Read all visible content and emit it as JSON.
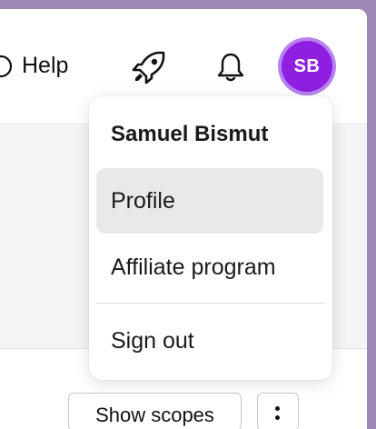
{
  "header": {
    "help_label": "Help",
    "icons": {
      "help": "help-circle-icon",
      "rocket": "rocket-icon",
      "bell": "bell-icon"
    },
    "avatar_initials": "SB"
  },
  "user_menu": {
    "user_name": "Samuel Bismut",
    "items": [
      {
        "label": "Profile",
        "active": true
      },
      {
        "label": "Affiliate program",
        "active": false
      },
      {
        "label": "Sign out",
        "active": false
      }
    ]
  },
  "toolbar": {
    "show_scopes_label": "Show scopes",
    "more_icon": "vertical-dots-icon"
  },
  "colors": {
    "avatar_bg": "#8e1fe0",
    "avatar_ring": "#b782f0",
    "active_item_bg": "#e9e9ec",
    "frame": "#a088b4"
  }
}
